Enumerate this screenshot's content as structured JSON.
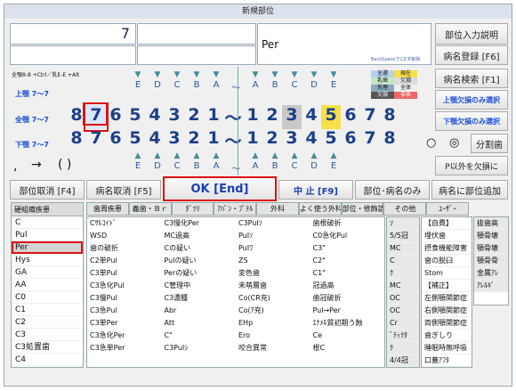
{
  "title": "新規部位",
  "input_main": "7",
  "input_per": "Per",
  "backspace_hint": "BackSpaceで1文字削除",
  "buttons": {
    "explain": "部位入力説明",
    "register": "病名登録 [F6]",
    "search": "病名検索 [F1]",
    "upper_missing": "上顎欠損のみ選択",
    "lower_missing": "下顎欠損のみ選択",
    "split": "分割歯",
    "except_p": "P以外を欠損に",
    "cancel_part": "部位取消 [F4]",
    "cancel_disease": "病名取消 [F5]",
    "ok": "OK [End]",
    "stop": "中 止 [F9]",
    "part_disease_only": "部位･病名のみ",
    "add_to_part": "病名に部位追加"
  },
  "hint_keys": "全顎8-8 +Ctrl／乳E-E +Alt",
  "jaw_labels": {
    "upper": "上顎 7～7",
    "full": "全顎 7～7",
    "lower": "下顎 7～7"
  },
  "symbols": {
    "comma": ",",
    "arrow": "→",
    "paren": "( )"
  },
  "radios": {
    "a": "○",
    "b": "◎"
  },
  "letters_upper": [
    "E",
    "D",
    "C",
    "B",
    "A",
    "～",
    "A",
    "B",
    "C",
    "D",
    "E"
  ],
  "letters_lower": [
    "E",
    "D",
    "C",
    "B",
    "A",
    "～",
    "A",
    "B",
    "C",
    "D",
    "E"
  ],
  "teeth_upper": [
    "8",
    "7",
    "6",
    "5",
    "4",
    "3",
    "2",
    "1",
    "～",
    "1",
    "2",
    "3",
    "4",
    "5",
    "6",
    "7",
    "8"
  ],
  "teeth_lower": [
    "8",
    "7",
    "6",
    "5",
    "4",
    "3",
    "2",
    "1",
    "～",
    "1",
    "2",
    "3",
    "4",
    "5",
    "6",
    "7",
    "8"
  ],
  "tri_up": "▼",
  "tri_down": "▲",
  "legend": [
    "全選",
    "現在",
    "乳歯",
    "欠損",
    "先埋",
    "全体",
    "欠損",
    "非表"
  ],
  "tabs": [
    "歯周疾患",
    "義歯・Ｂｒ",
    "ﾀﾞﾂﾘ",
    "ｱﾊﾟﾝ・ﾌﾞﾃﾙ",
    "外科",
    "よく使う外科",
    "部位・修飾語",
    "その他",
    "ﾕｰｻﾞｰ"
  ],
  "list_header": "硬組織疾患",
  "list_items": [
    "C",
    "Pul",
    "Per",
    "Hys",
    "GA",
    "AA",
    "C0",
    "C1",
    "C2",
    "C3",
    "C3処置歯",
    "C4"
  ],
  "grid_items": [
    "Cｻﾙｺｲﾄﾞ",
    "C3慢化Per",
    "C3PuIｿ",
    "歯根破折",
    "WSD",
    "MC過高",
    "PuIｿ",
    "C0急化Pul",
    "歯の破折",
    "Cの疑い",
    "PuIﾜ",
    "C3\"",
    "C2単Pul",
    "Pulの疑い",
    "ZS",
    "C2\"",
    "C3単Pul",
    "Perの疑い",
    "変色歯",
    "C1\"",
    "C3急化Pul",
    "C管理中",
    "未萌層歯",
    "冠過高",
    "C3慢Pul",
    "C3濃腫",
    "Co(CR充)",
    "歯冠破折",
    "C3急Pul",
    "Abr",
    "Co(ｱ充)",
    "Pul→Per",
    "C3単Per",
    "Att",
    "EHp",
    "ｴﾅﾒﾙ質初期う蝕",
    "C3急化Per",
    "C\"",
    "Ero",
    "Ce",
    "C3急単Per",
    "C3PuIｼ",
    "咬合異常",
    "根C"
  ],
  "right_a": [
    "ｿ",
    "5/5冠",
    "MC",
    "C",
    "ｸ",
    "MC",
    "OC",
    "OC",
    "Cr",
    "ﾞﾃｨｸﾀ",
    "ｸ",
    "4/4冠"
  ],
  "right_b": [
    "【自費】",
    "埋伏歯",
    "摂食機能障害",
    "歯の脱臼",
    "Stom",
    "【補正】",
    "左側顎関節症",
    "右側顎関節症",
    "両側顎関節症",
    "歯ぎしり",
    "睡眠時無呼吸",
    "口蓋ｱﾌﾀ"
  ],
  "right_c": [
    "抜歯高",
    "顎骨壊",
    "顎骨壊",
    "顎骨骨",
    "金属ｱﾚ",
    "ｱﾚﾙｷﾞ"
  ]
}
